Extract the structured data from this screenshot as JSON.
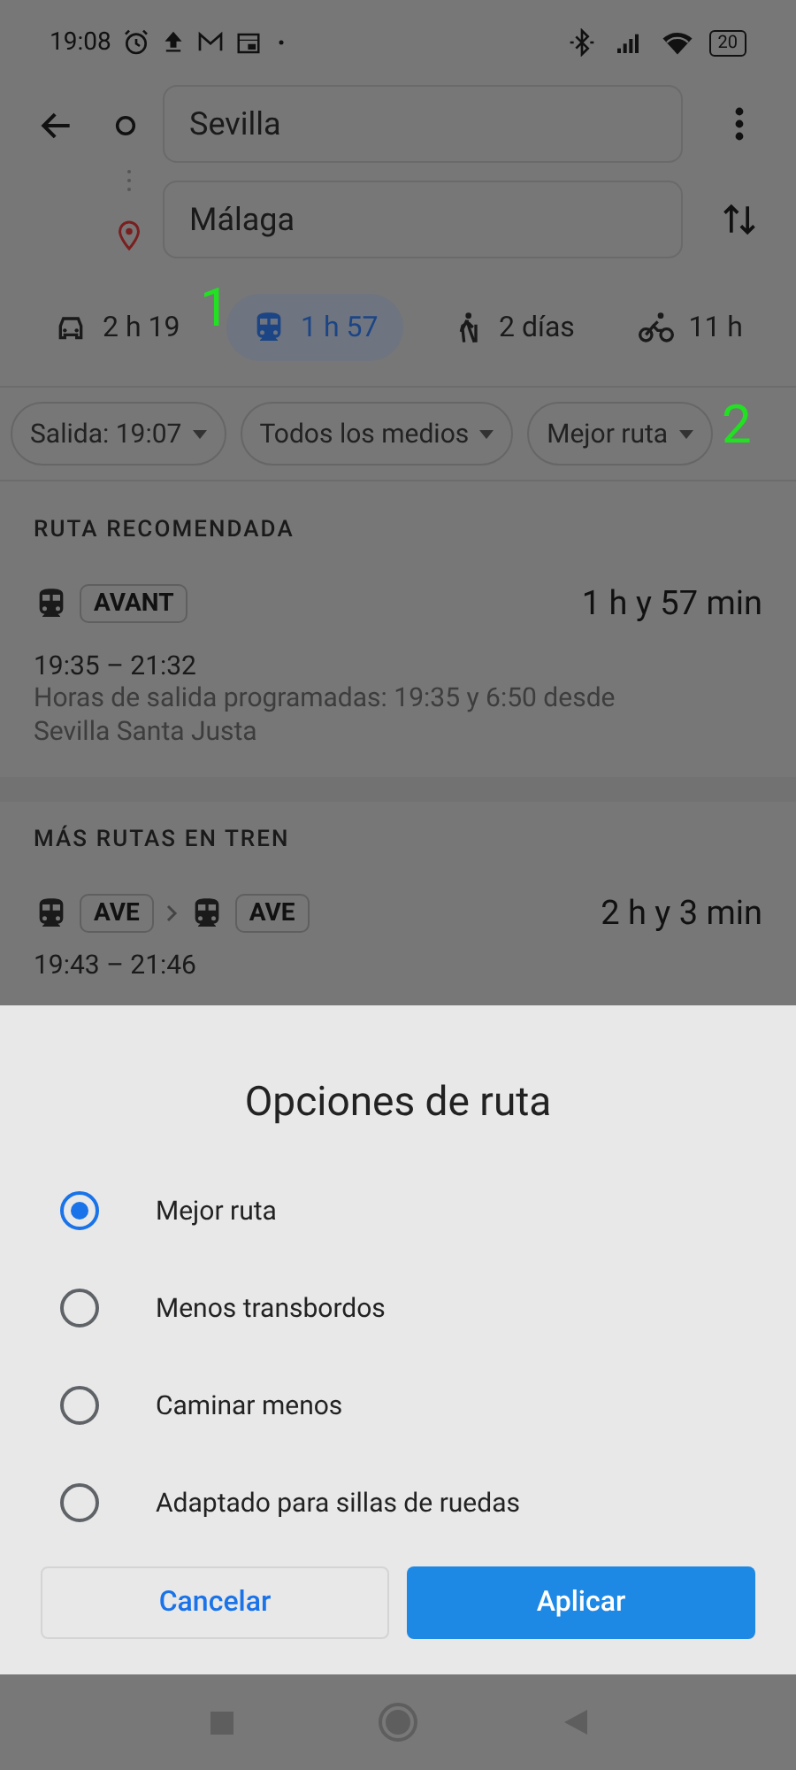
{
  "status_bar": {
    "time": "19:08",
    "battery": "20"
  },
  "route": {
    "origin": "Sevilla",
    "destination": "Málaga"
  },
  "modes": [
    {
      "kind": "car",
      "label": "2 h 19",
      "selected": false
    },
    {
      "kind": "transit",
      "label": "1 h 57",
      "selected": true
    },
    {
      "kind": "walk",
      "label": "2 días",
      "selected": false
    },
    {
      "kind": "bike",
      "label": "11 h",
      "selected": false
    }
  ],
  "filters": [
    "Salida: 19:07",
    "Todos los medios",
    "Mejor ruta"
  ],
  "sections": [
    {
      "heading": "RUTA RECOMENDADA",
      "routes": [
        {
          "lines": [
            "AVANT"
          ],
          "duration": "1 h y 57 min",
          "times": "19:35 – 21:32",
          "note": "Horas de salida programadas: 19:35 y 6:50 desde Sevilla Santa Justa"
        }
      ]
    },
    {
      "heading": "MÁS RUTAS EN TREN",
      "routes": [
        {
          "lines": [
            "AVE",
            "AVE"
          ],
          "duration": "2 h y 3 min",
          "times": "19:43 – 21:46"
        }
      ]
    }
  ],
  "sheet": {
    "title": "Opciones de ruta",
    "options": [
      {
        "label": "Mejor ruta",
        "selected": true
      },
      {
        "label": "Menos transbordos",
        "selected": false
      },
      {
        "label": "Caminar menos",
        "selected": false
      },
      {
        "label": "Adaptado para sillas de ruedas",
        "selected": false
      }
    ],
    "buttons": {
      "cancel": "Cancelar",
      "apply": "Aplicar"
    }
  },
  "annotations": [
    "1",
    "2"
  ]
}
